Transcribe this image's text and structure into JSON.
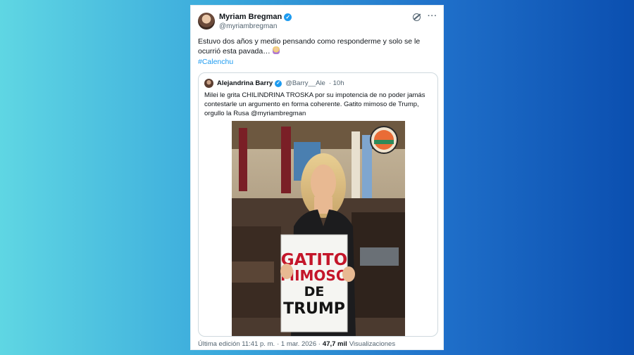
{
  "tweet": {
    "author_name": "Myriam Bregman",
    "author_handle": "@myriambregman",
    "body": "Estuvo dos años y medio pensando como responderme y solo se le ocurrió esta pavada…",
    "hashtag": "#Calenchu",
    "icons": [
      "grok-icon",
      "more-icon"
    ]
  },
  "quoted": {
    "author_name": "Alejandrina Barry",
    "author_handle": "@Barry__Ale",
    "time": "· 10h",
    "text": "Milei le grita CHILINDRINA TROSKA por su impotencia de no poder  jamás contestarle un argumento en forma coherente. Gatito mimoso de Trump, orgullo la Rusa @myriambregman",
    "image": {
      "sign_lines": [
        "GATITO",
        "MIMOSO",
        "DE",
        "TRUMP"
      ],
      "sign_colors": [
        "#c4162a",
        "#c4162a",
        "#141414",
        "#141414"
      ]
    }
  },
  "footer": {
    "edited": "Última edición 11:41 p. m.",
    "date": "· 1 mar. 2026 ·",
    "views": "47,7 mil",
    "views_label": "Visualizaciones"
  },
  "colors": {
    "accent": "#1d9bf0",
    "text": "#0f1419",
    "muted": "#536471"
  }
}
